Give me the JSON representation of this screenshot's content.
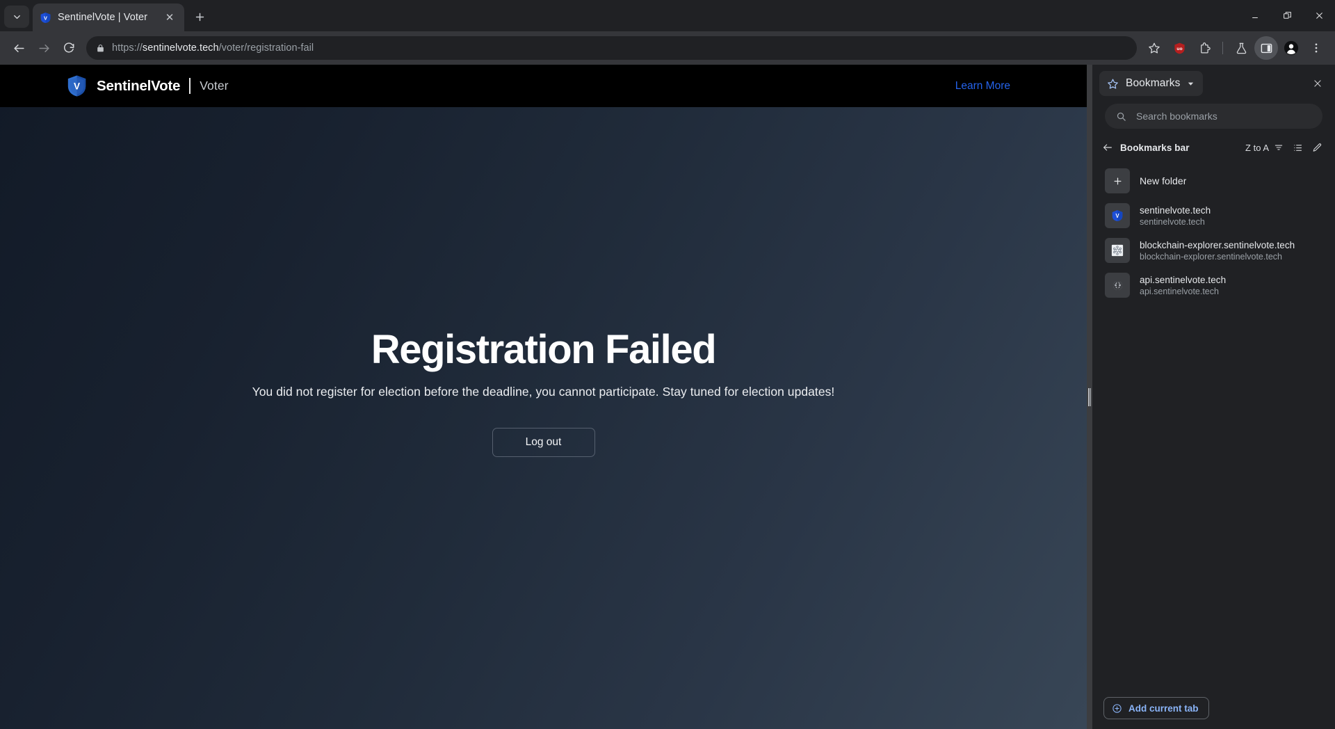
{
  "browser": {
    "tab": {
      "title": "SentinelVote | Voter",
      "favicon_name": "sentinelvote-shield-favicon",
      "close_label": "✕"
    },
    "tab_search_icon": "chevron-down-icon",
    "new_tab_label": "+",
    "window_controls": {
      "minimize": "minimize-icon",
      "maximize": "restore-icon",
      "close": "close-icon"
    },
    "nav": {
      "back": "back-arrow-icon",
      "forward": "forward-arrow-icon",
      "reload": "reload-icon"
    },
    "omnibox": {
      "lock_icon": "lock-icon",
      "url_scheme": "https://",
      "url_host": "sentinelvote.tech",
      "url_path": "/voter/registration-fail",
      "full_url": "https://sentinelvote.tech/voter/registration-fail"
    },
    "toolbar_icons": [
      {
        "name": "bookmark-star-icon"
      },
      {
        "name": "ublock-origin-extension-icon",
        "color": "#b51f1f"
      },
      {
        "name": "extensions-puzzle-icon"
      },
      {
        "name": "lab-flask-icon"
      },
      {
        "name": "side-panel-toggle-icon",
        "active": true
      },
      {
        "name": "profile-avatar-icon"
      },
      {
        "name": "chrome-menu-icon"
      }
    ]
  },
  "page": {
    "header": {
      "logo_name": "sentinelvote-shield-logo",
      "brand": "SentinelVote",
      "section": "Voter",
      "learn_more": "Learn More",
      "learn_more_color": "#2563eb",
      "background": "#000000"
    },
    "headline": "Registration Failed",
    "subtext": "You did not register for election before the deadline, you cannot participate. Stay tuned for election updates!",
    "logout_button": "Log out"
  },
  "sidepanel": {
    "title": "Bookmarks",
    "title_icon": "bookmarks-star-icon",
    "dropdown_icon": "chevron-down-icon",
    "close_icon": "close-icon",
    "search": {
      "placeholder": "Search bookmarks",
      "value": "",
      "icon": "search-icon"
    },
    "breadcrumb": {
      "back_icon": "back-arrow-icon",
      "title": "Bookmarks bar",
      "sort_label": "Z to A",
      "sort_icon": "sort-icon",
      "view_icon": "list-view-icon",
      "edit_icon": "pencil-edit-icon"
    },
    "items": [
      {
        "title": "New folder",
        "subtitle": "",
        "icon": "plus-icon",
        "type": "folder"
      },
      {
        "title": "sentinelvote.tech",
        "subtitle": "sentinelvote.tech",
        "icon": "sentinelvote-shield-favicon",
        "type": "bookmark"
      },
      {
        "title": "blockchain-explorer.sentinelvote.tech",
        "subtitle": "blockchain-explorer.sentinelvote.tech",
        "icon": "blockchain-node-favicon",
        "type": "bookmark"
      },
      {
        "title": "api.sentinelvote.tech",
        "subtitle": "api.sentinelvote.tech",
        "icon": "globe-favicon",
        "type": "bookmark"
      }
    ],
    "add_current_tab": {
      "label": "Add current tab",
      "icon": "plus-circle-icon",
      "color": "#8ab4f8"
    },
    "resizer_icon": "drag-handle-icon"
  }
}
